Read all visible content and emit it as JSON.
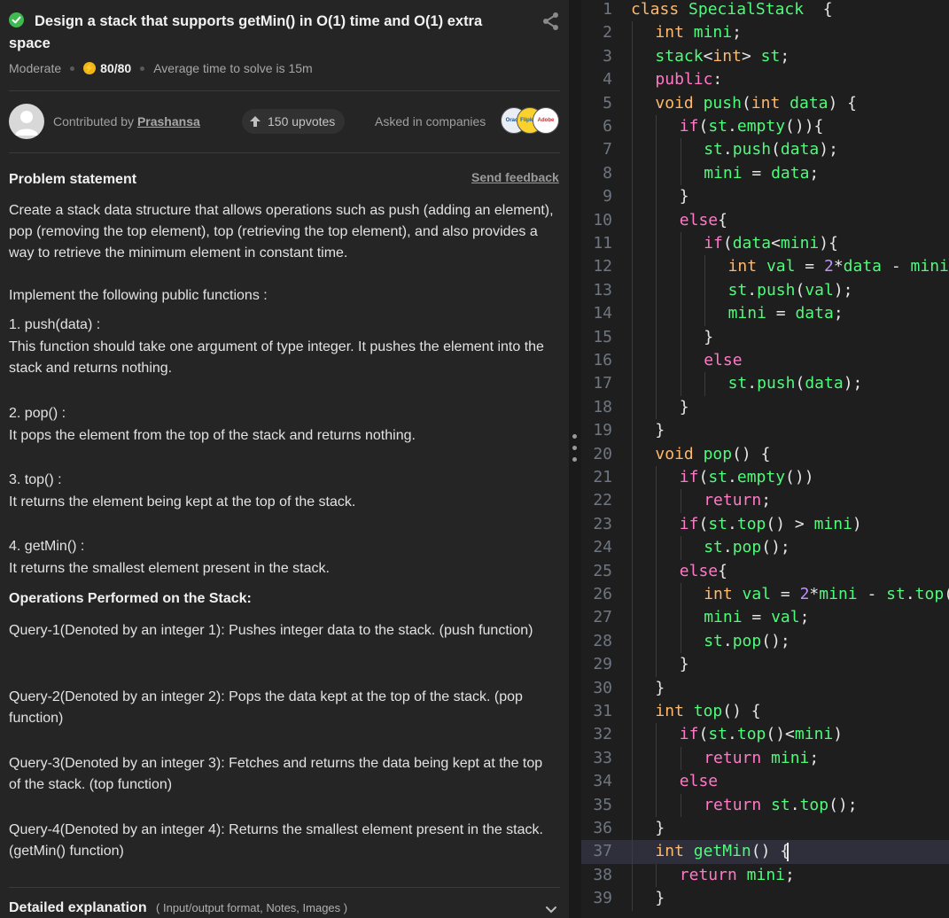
{
  "problem": {
    "title": "Design a stack that supports getMin() in O(1) time and O(1) extra space",
    "difficulty": "Moderate",
    "score": "80/80",
    "avg_time": "Average time to solve is 15m",
    "contributed_prefix": "Contributed by",
    "contributor": "Prashansa",
    "upvotes": "150 upvotes",
    "asked_in": "Asked in companies",
    "company_logos": [
      "Oracle",
      "Flipkart",
      "Adobe"
    ],
    "statement_heading": "Problem statement",
    "send_feedback": "Send feedback",
    "paragraphs": [
      "Create a stack data structure that allows operations such as push (adding an element), pop (removing the top element), top (retrieving the top element), and also provides a way to retrieve the minimum element in constant time.",
      "Implement the following public functions :",
      "1. push(data) :",
      "This function should take one argument of type integer. It pushes the element into the stack and returns nothing.",
      "2. pop() :",
      "It pops the element from the top of the stack and returns nothing.",
      "3. top() :",
      "It returns the element being kept at the top of the stack.",
      "4.  getMin() :",
      "It returns the smallest element present in the stack."
    ],
    "operations_heading": "Operations Performed on the Stack:",
    "queries": [
      "Query-1(Denoted by an integer 1): Pushes integer data to the stack. (push function)",
      "Query-2(Denoted by an integer 2): Pops the data kept at the top of the stack. (pop function)",
      "Query-3(Denoted by an integer 3): Fetches and returns the data being kept at the top of the stack. (top function)",
      "Query-4(Denoted by an integer 4): Returns the smallest element present in the stack. (getMin() function)"
    ],
    "detailed_heading": "Detailed explanation",
    "detailed_sub": "( Input/output format, Notes, Images )"
  },
  "editor": {
    "theme_colors": {
      "keyword": "#ff79c6",
      "type": "#ffb86c",
      "function": "#50fa7b",
      "number": "#bd93f9",
      "identifier": "#8be9fd"
    },
    "current_line": 37,
    "lines": [
      {
        "n": "1",
        "indent": 0,
        "tokens": [
          [
            "ty",
            "class "
          ],
          [
            "fn",
            "SpecialStack"
          ],
          [
            "",
            "  {"
          ]
        ]
      },
      {
        "n": "2",
        "indent": 1,
        "tokens": [
          [
            "ty",
            "int "
          ],
          [
            "fn",
            "mini"
          ],
          [
            "",
            ";"
          ]
        ]
      },
      {
        "n": "3",
        "indent": 1,
        "tokens": [
          [
            "fn",
            "stack"
          ],
          [
            "",
            "<"
          ],
          [
            "ty",
            "int"
          ],
          [
            "",
            "> "
          ],
          [
            "fn",
            "st"
          ],
          [
            "",
            ";"
          ]
        ]
      },
      {
        "n": "4",
        "indent": 1,
        "tokens": [
          [
            "kw",
            "public"
          ],
          [
            "",
            ":"
          ]
        ]
      },
      {
        "n": "5",
        "indent": 1,
        "tokens": [
          [
            "ty",
            "void "
          ],
          [
            "fn",
            "push"
          ],
          [
            "",
            "("
          ],
          [
            "ty",
            "int "
          ],
          [
            "fn",
            "data"
          ],
          [
            "",
            ") {"
          ]
        ]
      },
      {
        "n": "6",
        "indent": 2,
        "tokens": [
          [
            "kw",
            "if"
          ],
          [
            "",
            "("
          ],
          [
            "fn",
            "st"
          ],
          [
            "",
            "."
          ],
          [
            "fn",
            "empty"
          ],
          [
            "",
            "()){"
          ]
        ]
      },
      {
        "n": "7",
        "indent": 3,
        "tokens": [
          [
            "fn",
            "st"
          ],
          [
            "",
            "."
          ],
          [
            "fn",
            "push"
          ],
          [
            "",
            "("
          ],
          [
            "fn",
            "data"
          ],
          [
            "",
            ");"
          ]
        ]
      },
      {
        "n": "8",
        "indent": 3,
        "tokens": [
          [
            "fn",
            "mini"
          ],
          [
            "",
            " = "
          ],
          [
            "fn",
            "data"
          ],
          [
            "",
            ";"
          ]
        ]
      },
      {
        "n": "9",
        "indent": 2,
        "tokens": [
          [
            "",
            "}"
          ]
        ]
      },
      {
        "n": "10",
        "indent": 2,
        "tokens": [
          [
            "kw",
            "else"
          ],
          [
            "",
            "{"
          ]
        ]
      },
      {
        "n": "11",
        "indent": 3,
        "tokens": [
          [
            "kw",
            "if"
          ],
          [
            "",
            "("
          ],
          [
            "fn",
            "data"
          ],
          [
            "",
            "<"
          ],
          [
            "fn",
            "mini"
          ],
          [
            "",
            "){"
          ]
        ]
      },
      {
        "n": "12",
        "indent": 4,
        "tokens": [
          [
            "ty",
            "int "
          ],
          [
            "fn",
            "val"
          ],
          [
            "",
            " = "
          ],
          [
            "num",
            "2"
          ],
          [
            "",
            "*"
          ],
          [
            "fn",
            "data"
          ],
          [
            "",
            " - "
          ],
          [
            "fn",
            "mini"
          ],
          [
            "",
            ";"
          ]
        ]
      },
      {
        "n": "13",
        "indent": 4,
        "tokens": [
          [
            "fn",
            "st"
          ],
          [
            "",
            "."
          ],
          [
            "fn",
            "push"
          ],
          [
            "",
            "("
          ],
          [
            "fn",
            "val"
          ],
          [
            "",
            ");"
          ]
        ]
      },
      {
        "n": "14",
        "indent": 4,
        "tokens": [
          [
            "fn",
            "mini"
          ],
          [
            "",
            " = "
          ],
          [
            "fn",
            "data"
          ],
          [
            "",
            ";"
          ]
        ]
      },
      {
        "n": "15",
        "indent": 3,
        "tokens": [
          [
            "",
            "}"
          ]
        ]
      },
      {
        "n": "16",
        "indent": 3,
        "tokens": [
          [
            "kw",
            "else"
          ]
        ]
      },
      {
        "n": "17",
        "indent": 4,
        "tokens": [
          [
            "fn",
            "st"
          ],
          [
            "",
            "."
          ],
          [
            "fn",
            "push"
          ],
          [
            "",
            "("
          ],
          [
            "fn",
            "data"
          ],
          [
            "",
            ");"
          ]
        ]
      },
      {
        "n": "18",
        "indent": 2,
        "tokens": [
          [
            "",
            "}"
          ]
        ]
      },
      {
        "n": "19",
        "indent": 1,
        "tokens": [
          [
            "",
            "}"
          ]
        ]
      },
      {
        "n": "20",
        "indent": 1,
        "tokens": [
          [
            "ty",
            "void "
          ],
          [
            "fn",
            "pop"
          ],
          [
            "",
            "() {"
          ]
        ]
      },
      {
        "n": "21",
        "indent": 2,
        "tokens": [
          [
            "kw",
            "if"
          ],
          [
            "",
            "("
          ],
          [
            "fn",
            "st"
          ],
          [
            "",
            "."
          ],
          [
            "fn",
            "empty"
          ],
          [
            "",
            "())"
          ]
        ]
      },
      {
        "n": "22",
        "indent": 3,
        "tokens": [
          [
            "kw",
            "return"
          ],
          [
            "",
            ";"
          ]
        ]
      },
      {
        "n": "23",
        "indent": 2,
        "tokens": [
          [
            "kw",
            "if"
          ],
          [
            "",
            "("
          ],
          [
            "fn",
            "st"
          ],
          [
            "",
            "."
          ],
          [
            "fn",
            "top"
          ],
          [
            "",
            "() > "
          ],
          [
            "fn",
            "mini"
          ],
          [
            "",
            ")"
          ]
        ]
      },
      {
        "n": "24",
        "indent": 3,
        "tokens": [
          [
            "fn",
            "st"
          ],
          [
            "",
            "."
          ],
          [
            "fn",
            "pop"
          ],
          [
            "",
            "();"
          ]
        ]
      },
      {
        "n": "25",
        "indent": 2,
        "tokens": [
          [
            "kw",
            "else"
          ],
          [
            "",
            "{"
          ]
        ]
      },
      {
        "n": "26",
        "indent": 3,
        "tokens": [
          [
            "ty",
            "int "
          ],
          [
            "fn",
            "val"
          ],
          [
            "",
            " = "
          ],
          [
            "num",
            "2"
          ],
          [
            "",
            "*"
          ],
          [
            "fn",
            "mini"
          ],
          [
            "",
            " - "
          ],
          [
            "fn",
            "st"
          ],
          [
            "",
            "."
          ],
          [
            "fn",
            "top"
          ],
          [
            "",
            "();"
          ]
        ]
      },
      {
        "n": "27",
        "indent": 3,
        "tokens": [
          [
            "fn",
            "mini"
          ],
          [
            "",
            " = "
          ],
          [
            "fn",
            "val"
          ],
          [
            "",
            ";"
          ]
        ]
      },
      {
        "n": "28",
        "indent": 3,
        "tokens": [
          [
            "fn",
            "st"
          ],
          [
            "",
            "."
          ],
          [
            "fn",
            "pop"
          ],
          [
            "",
            "();"
          ]
        ]
      },
      {
        "n": "29",
        "indent": 2,
        "tokens": [
          [
            "",
            "}"
          ]
        ]
      },
      {
        "n": "30",
        "indent": 1,
        "tokens": [
          [
            "",
            "}"
          ]
        ]
      },
      {
        "n": "31",
        "indent": 1,
        "tokens": [
          [
            "ty",
            "int "
          ],
          [
            "fn",
            "top"
          ],
          [
            "",
            "() {"
          ]
        ]
      },
      {
        "n": "32",
        "indent": 2,
        "tokens": [
          [
            "kw",
            "if"
          ],
          [
            "",
            "("
          ],
          [
            "fn",
            "st"
          ],
          [
            "",
            "."
          ],
          [
            "fn",
            "top"
          ],
          [
            "",
            "()<"
          ],
          [
            "fn",
            "mini"
          ],
          [
            "",
            ")"
          ]
        ]
      },
      {
        "n": "33",
        "indent": 3,
        "tokens": [
          [
            "kw",
            "return "
          ],
          [
            "fn",
            "mini"
          ],
          [
            "",
            ";"
          ]
        ]
      },
      {
        "n": "34",
        "indent": 2,
        "tokens": [
          [
            "kw",
            "else"
          ]
        ]
      },
      {
        "n": "35",
        "indent": 3,
        "tokens": [
          [
            "kw",
            "return "
          ],
          [
            "fn",
            "st"
          ],
          [
            "",
            "."
          ],
          [
            "fn",
            "top"
          ],
          [
            "",
            "();"
          ]
        ]
      },
      {
        "n": "36",
        "indent": 1,
        "tokens": [
          [
            "",
            "}"
          ]
        ]
      },
      {
        "n": "37",
        "indent": 1,
        "tokens": [
          [
            "ty",
            "int "
          ],
          [
            "fn",
            "getMin"
          ],
          [
            "",
            "() {"
          ]
        ]
      },
      {
        "n": "38",
        "indent": 2,
        "tokens": [
          [
            "kw",
            "return "
          ],
          [
            "fn",
            "mini"
          ],
          [
            "",
            ";"
          ]
        ]
      },
      {
        "n": "39",
        "indent": 1,
        "tokens": [
          [
            "",
            "}"
          ]
        ]
      }
    ]
  }
}
